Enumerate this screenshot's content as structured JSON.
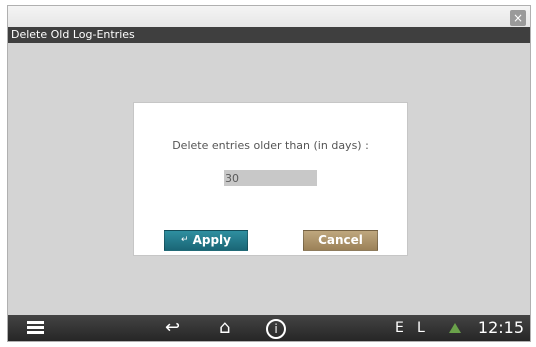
{
  "window": {
    "title": "Delete Old Log-Entries",
    "close_label": "×"
  },
  "dialog": {
    "prompt": "Delete entries older than (in days) :",
    "days_value": "30",
    "apply_label": "Apply",
    "apply_icon": "↵",
    "cancel_label": "Cancel"
  },
  "bottombar": {
    "menu_icon": "menu-icon",
    "back_icon": "↩",
    "home_icon": "⌂",
    "info_icon": "i",
    "status_e": "E",
    "status_l": "L",
    "warning_color": "#6aa24a",
    "clock": "12:15"
  },
  "colors": {
    "titlebar": "#3f3f3f",
    "apply_button": "#1a6676",
    "cancel_button": "#9b8158",
    "background": "#d4d4d4"
  }
}
